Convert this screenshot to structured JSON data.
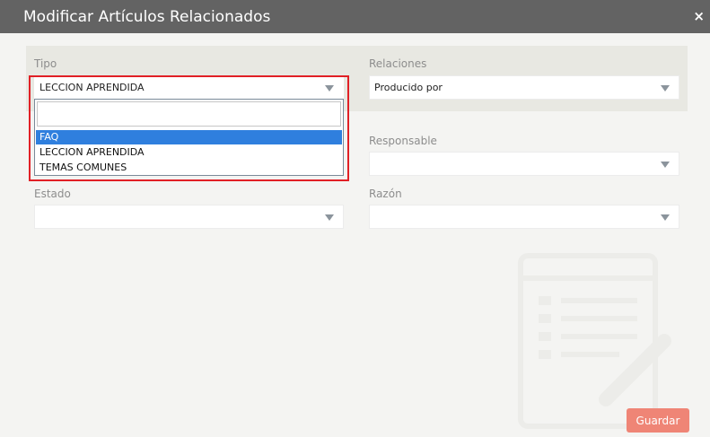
{
  "dialog": {
    "title": "Modificar Artículos Relacionados",
    "close_icon": "×"
  },
  "fields": {
    "tipo": {
      "label": "Tipo",
      "value": "LECCION APRENDIDA"
    },
    "relaciones": {
      "label": "Relaciones",
      "value": "Producido por"
    },
    "responsable": {
      "label": "Responsable",
      "value": ""
    },
    "estado": {
      "label": "Estado",
      "value": ""
    },
    "razon": {
      "label": "Razón",
      "value": ""
    }
  },
  "tipo_dropdown": {
    "search_value": "",
    "options": [
      "FAQ",
      "LECCION APRENDIDA",
      "TEMAS COMUNES"
    ],
    "highlighted": "FAQ"
  },
  "footer": {
    "save_label": "Guardar"
  },
  "colors": {
    "title_bar": "#636363",
    "highlight": "#2f7fde",
    "annotation_box": "#e12026",
    "save_button": "#ef8576"
  },
  "icons": {
    "dropdown": "triangle-down-icon",
    "watermark": "document-pencil-icon"
  }
}
